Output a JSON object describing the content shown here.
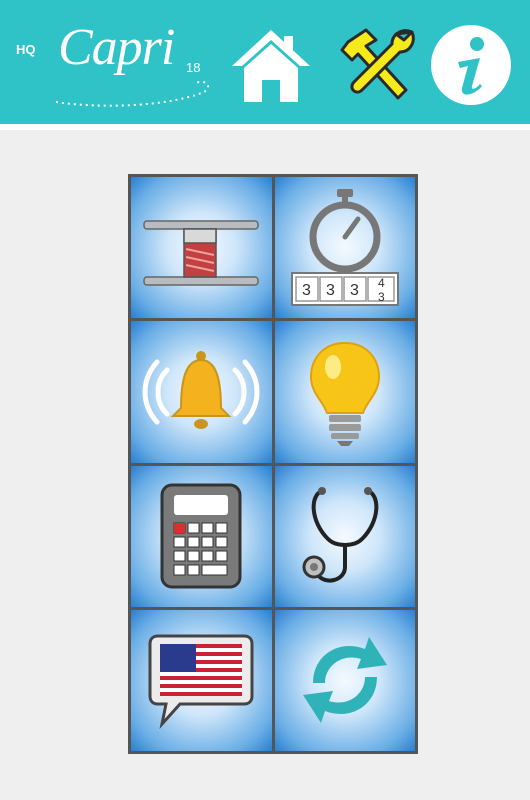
{
  "header": {
    "logo": {
      "prefix": "HQ",
      "name": "Capri",
      "version": "18"
    },
    "buttons": [
      {
        "icon": "home-icon",
        "color": "#ffffff"
      },
      {
        "icon": "tools-icon",
        "color": "#f6ea1a"
      },
      {
        "icon": "info-icon",
        "color": "#ffffff"
      }
    ]
  },
  "tiles": [
    {
      "icon": "thread-spool-icon"
    },
    {
      "icon": "stitch-counter-timer-icon",
      "digits": [
        "3",
        "3",
        "3",
        "4",
        "3"
      ]
    },
    {
      "icon": "alarm-bell-icon"
    },
    {
      "icon": "light-bulb-icon"
    },
    {
      "icon": "calculator-icon"
    },
    {
      "icon": "stethoscope-icon"
    },
    {
      "icon": "language-flag-icon"
    },
    {
      "icon": "sync-refresh-icon"
    }
  ],
  "colors": {
    "header_bg": "#2fc3c8",
    "page_bg": "#efefef",
    "tile_center": "#f4faff",
    "tile_edge": "#2a7fd0",
    "grid_border": "#555555"
  }
}
